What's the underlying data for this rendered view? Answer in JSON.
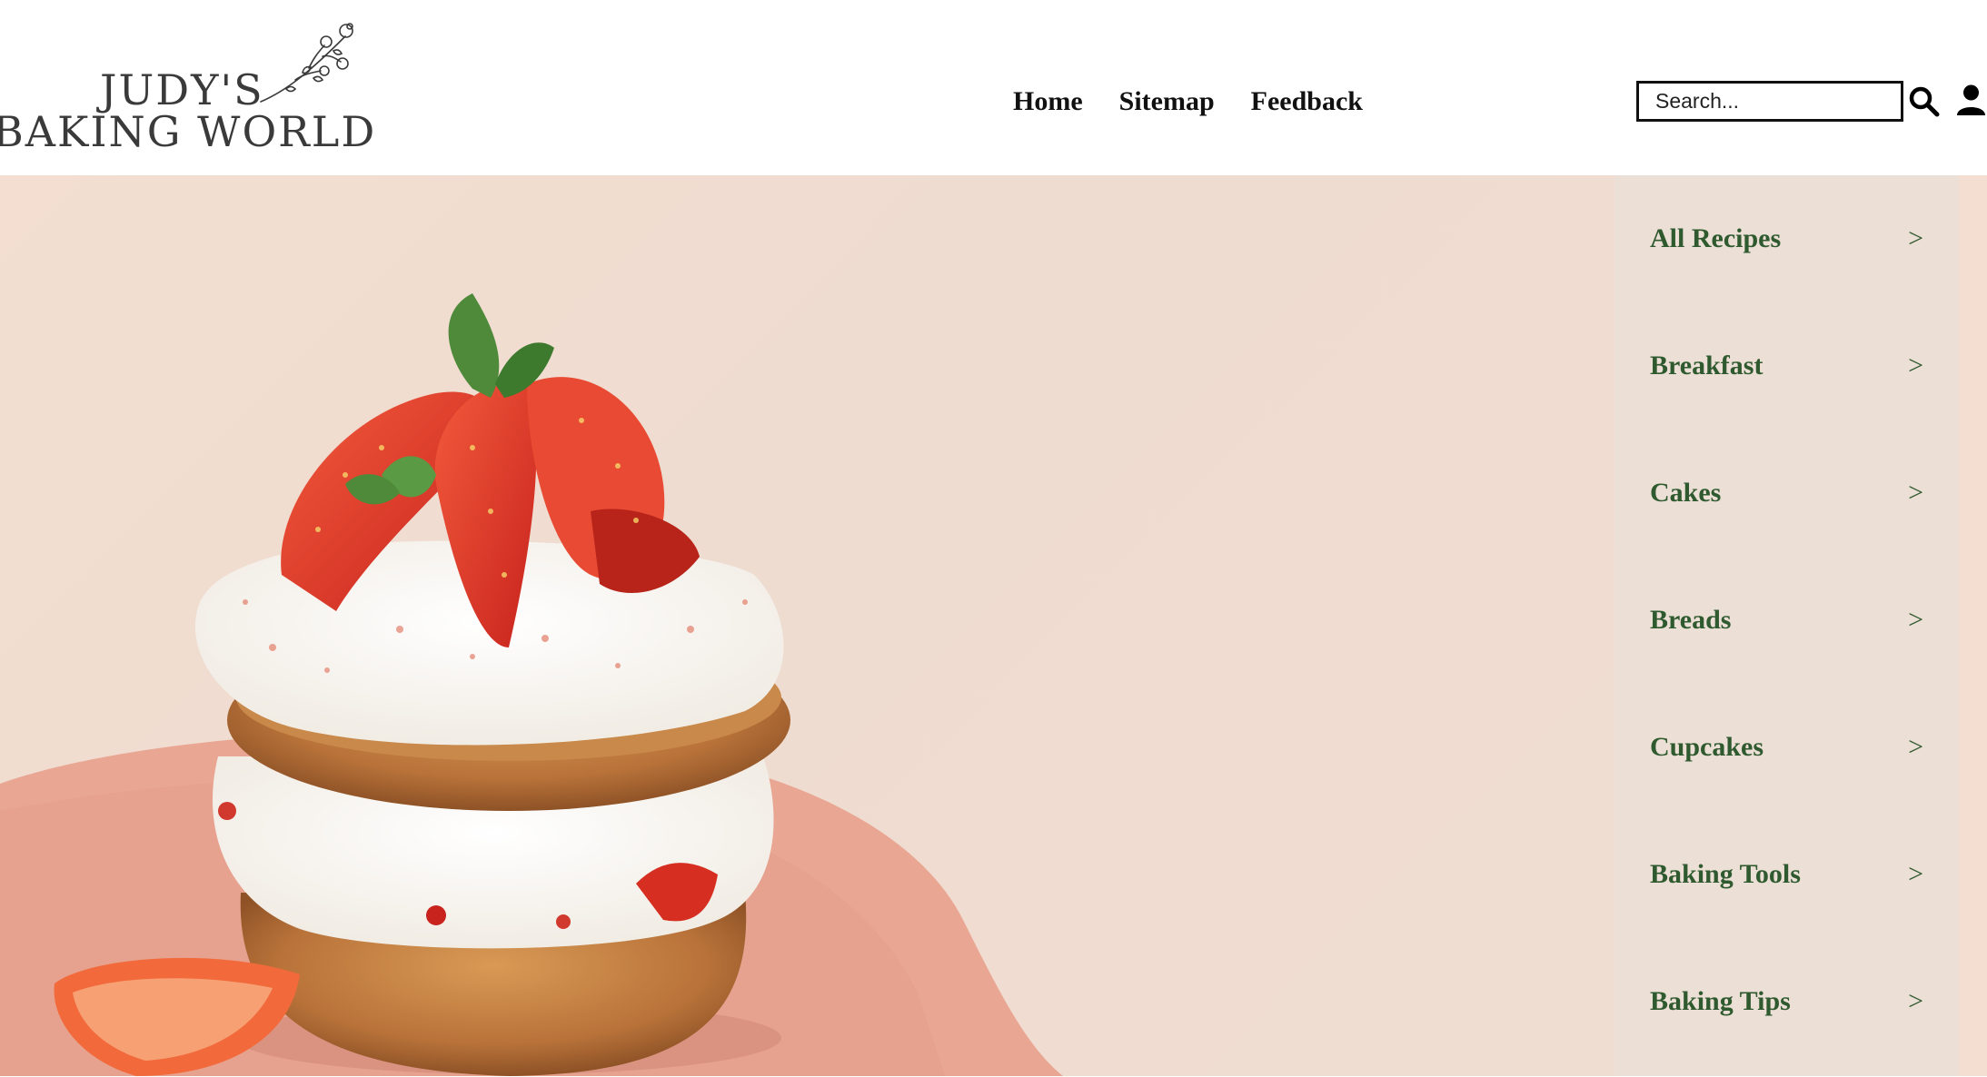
{
  "brand": {
    "line1": "JUDY'S",
    "line2": "BAKING WORLD"
  },
  "nav": {
    "items": [
      {
        "label": "Home"
      },
      {
        "label": "Sitemap"
      },
      {
        "label": "Feedback"
      }
    ]
  },
  "search": {
    "placeholder": "Search...",
    "value": "",
    "icon": "search-icon"
  },
  "account": {
    "icon": "user-icon"
  },
  "hero": {
    "image": "strawberry-shortcake-photo"
  },
  "sidebar": {
    "items": [
      {
        "label": "All Recipes",
        "chevron": ">"
      },
      {
        "label": "Breakfast",
        "chevron": ">"
      },
      {
        "label": "Cakes",
        "chevron": ">"
      },
      {
        "label": "Breads",
        "chevron": ">"
      },
      {
        "label": "Cupcakes",
        "chevron": ">"
      },
      {
        "label": "Baking Tools",
        "chevron": ">"
      },
      {
        "label": "Baking Tips",
        "chevron": ">"
      }
    ]
  },
  "colors": {
    "sidebar_text": "#2f5a2f",
    "sidebar_bg": "#ecdfd5",
    "hero_bg": "#f0ddd1",
    "plate": "#e9a693"
  }
}
